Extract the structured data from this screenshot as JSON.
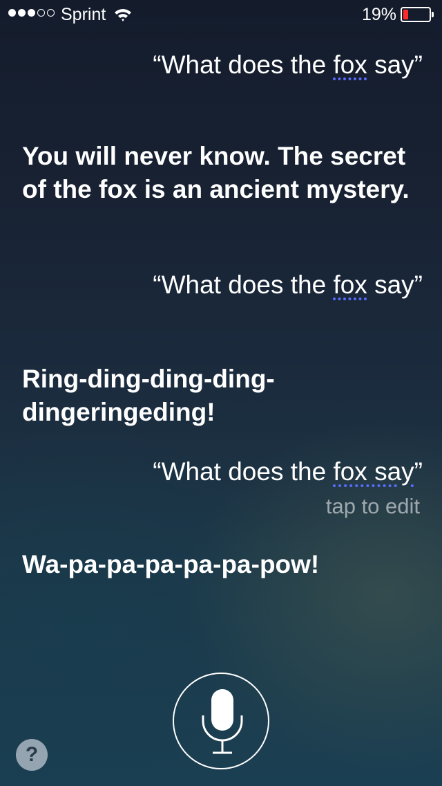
{
  "status_bar": {
    "signal_strength": {
      "filled": 3,
      "total": 5
    },
    "carrier": "Sprint",
    "battery_percent_text": "19%",
    "battery_level": 0.19,
    "battery_color": "#ff2a2a"
  },
  "conversation": [
    {
      "role": "user",
      "text_before": "“What does the ",
      "underlined": "fox",
      "text_after": " say”"
    },
    {
      "role": "assistant",
      "text": "You will never know. The secret of the fox is an ancient mystery."
    },
    {
      "role": "user",
      "text_before": "“What does the ",
      "underlined": "fox",
      "text_after": " say”"
    },
    {
      "role": "assistant",
      "text": "Ring-ding-ding-ding-dingeringeding!"
    },
    {
      "role": "user",
      "text_before": "“What does the ",
      "underlined": "fox say",
      "text_after": "”"
    },
    {
      "role": "assistant",
      "text": "Wa-pa-pa-pa-pa-pa-pow!"
    }
  ],
  "tap_to_edit": "tap to edit",
  "help_button": {
    "label": "?",
    "icon": "question-mark-icon"
  },
  "mic_button": {
    "icon": "microphone-icon"
  },
  "colors": {
    "underline": "#5a6cff",
    "text": "#ffffff"
  }
}
